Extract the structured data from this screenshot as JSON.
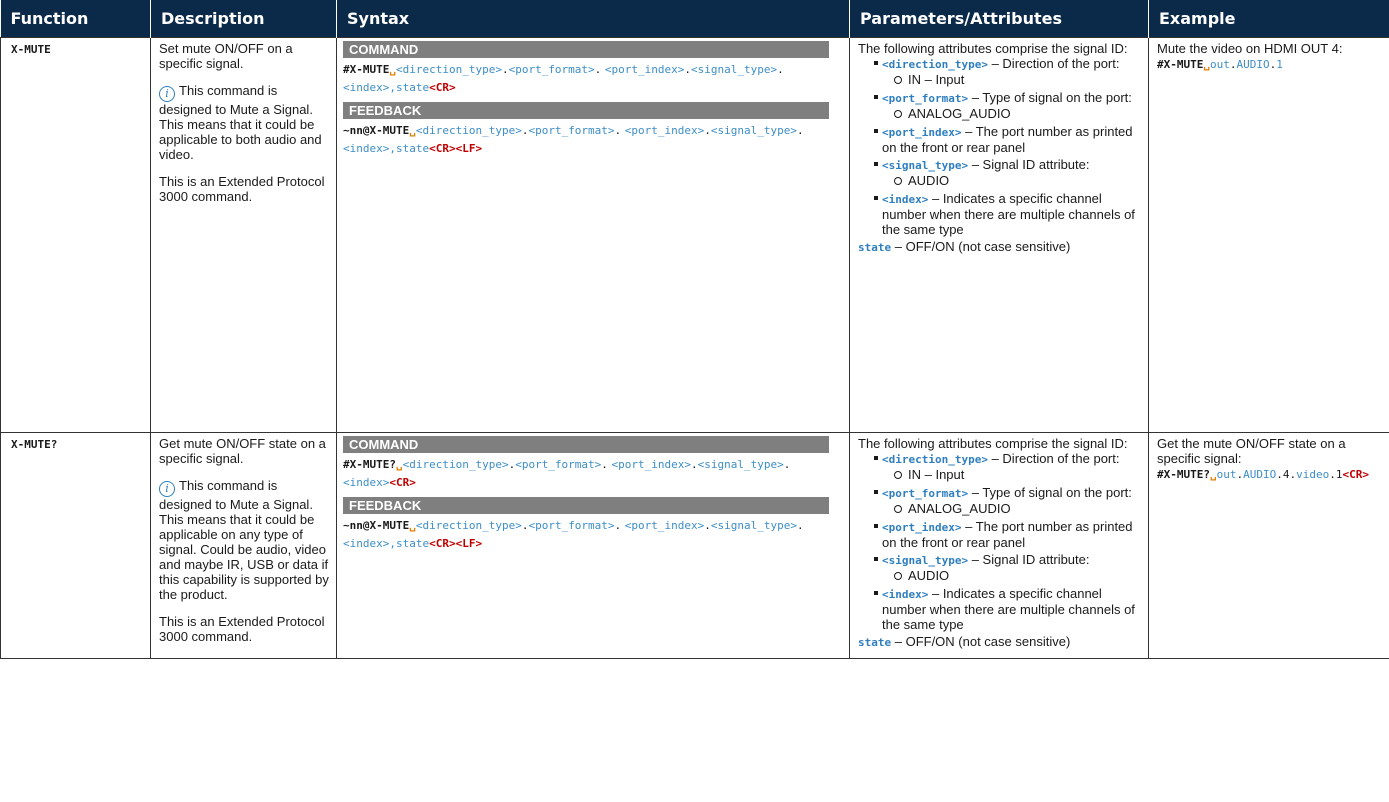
{
  "headers": {
    "function": "Function",
    "description": "Description",
    "syntax": "Syntax",
    "parameters": "Parameters/Attributes",
    "example": "Example"
  },
  "common": {
    "command_label": "COMMAND",
    "feedback_label": "FEEDBACK",
    "note_icon": "info-icon",
    "attr_intro": "The following attributes comprise the signal ID:",
    "direction_type": "<direction_type>",
    "direction_desc": " – Direction of the port:",
    "direction_opt": "IN – Input",
    "port_format": "<port_format>",
    "port_format_desc": " – Type of signal on the port:",
    "port_format_opt": "ANALOG_AUDIO",
    "port_index": "<port_index>",
    "port_index_desc": " – The port number as printed on the front or rear panel",
    "signal_type": "<signal_type>",
    "signal_type_desc": " – Signal ID attribute:",
    "signal_type_opt": "AUDIO",
    "index": "<index>",
    "index_desc": " – Indicates a specific channel number when there are multiple channels of the same type",
    "state": "state",
    "state_desc": " – OFF/ON (not case sensitive)",
    "sep": ".",
    "p_direction": "<direction_type>",
    "p_port_format": "<port_format>",
    "p_port_index": "<port_index>",
    "p_signal_type": "<signal_type>",
    "p_index": "<index>",
    "comma_state": ",state",
    "cr": "<CR>",
    "lf": "<LF>",
    "space_mark": "␣",
    "fb_prefix": "~nn@X-MUTE"
  },
  "rows": [
    {
      "function": "X-MUTE",
      "desc_1": "Set mute ON/OFF on a specific signal.",
      "desc_note": "This command is designed to Mute a Signal. This means that it could be applicable to both audio and video.",
      "desc_3": "This is an Extended Protocol 3000 command.",
      "cmd_prefix": "#X-MUTE",
      "example_text": "Mute the video on HDMI OUT 4:",
      "example_cmd": "#X-MUTE",
      "example_p1": "out",
      "example_p2": ".",
      "example_p3": "AUDIO",
      "example_p4": ".",
      "example_p5": "1"
    },
    {
      "function": "X-MUTE?",
      "desc_1": "Get mute ON/OFF state on a specific signal.",
      "desc_note": "This command is designed to Mute a Signal. This means that it could be applicable on any type of signal. Could be audio, video and maybe IR, USB or data if this capability is supported by the product.",
      "desc_3": "This is an Extended Protocol 3000 command.",
      "cmd_prefix": "#X-MUTE?",
      "example_text": "Get the mute ON/OFF state on a specific signal:",
      "example_cmd": "#X-MUTE?",
      "example_p1": "out",
      "example_p2": ".",
      "example_p3": "AUDIO",
      "example_p4": ".4.",
      "example_p5": "video",
      "example_p6": ".1"
    }
  ]
}
